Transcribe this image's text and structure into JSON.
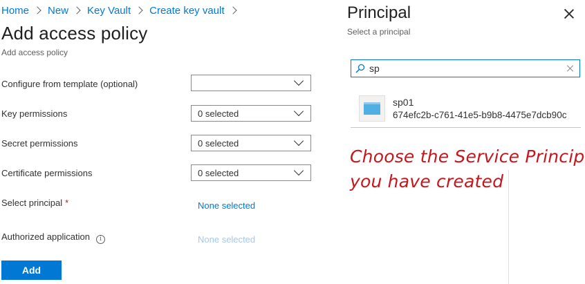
{
  "breadcrumb": [
    "Home",
    "New",
    "Key Vault",
    "Create key vault"
  ],
  "page": {
    "title": "Add access policy",
    "subtitle": "Add access policy"
  },
  "form": {
    "template": {
      "label": "Configure from template (optional)",
      "value": ""
    },
    "key_permissions": {
      "label": "Key permissions",
      "value": "0 selected"
    },
    "secret_permissions": {
      "label": "Secret permissions",
      "value": "0 selected"
    },
    "certificate_permissions": {
      "label": "Certificate permissions",
      "value": "0 selected"
    },
    "principal": {
      "label": "Select principal",
      "required_mark": "*",
      "value": "None selected"
    },
    "authorized_app": {
      "label": "Authorized application",
      "info_glyph": "i",
      "value": "None selected"
    },
    "add_label": "Add"
  },
  "blade": {
    "title": "Principal",
    "subtitle": "Select a principal",
    "search_value": "sp",
    "result": {
      "name": "sp01",
      "app_id": "674efc2b-c761-41e5-b9b8-4475e7dcb90c"
    }
  },
  "annotation": {
    "line1": "Choose the Service Principal",
    "line2": "you have created"
  },
  "colors": {
    "accent": "#0078d4",
    "annotation": "#c7161b",
    "required": "#a4262c"
  },
  "icons": [
    "chevron-right-icon",
    "chevron-down-icon",
    "info-icon",
    "close-icon",
    "search-icon",
    "clear-icon",
    "app-registration-icon"
  ]
}
